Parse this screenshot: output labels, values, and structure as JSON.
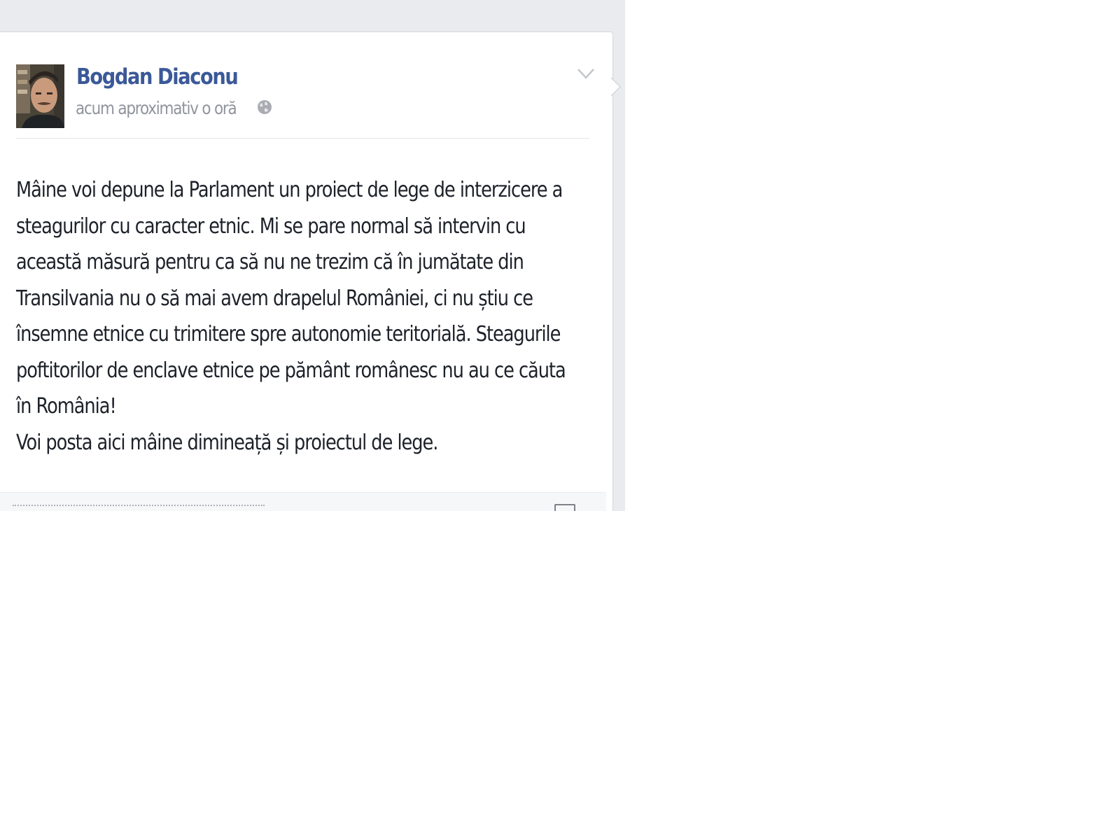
{
  "post": {
    "author": "Bogdan Diaconu",
    "timestamp": "acum aproximativ o oră",
    "privacy_icon": "globe-icon",
    "options_icon": "chevron-down-icon",
    "body": [
      "Mâine voi depune la Parlament un proiect de lege de interzicere a",
      "steagurilor cu caracter etnic. Mi se pare normal să intervin cu",
      "această măsură pentru ca să nu ne trezim că în jumătate din",
      "Transilvania nu o să mai avem drapelul României, ci nu știu ce",
      "însemne etnice cu trimitere spre autonomie teritorială. Steagurile",
      "poftitorilor de enclave etnice pe pământ românesc nu au ce căuta",
      "în România!",
      "Voi posta aici mâine dimineață și proiectul de lege."
    ]
  },
  "colors": {
    "link_blue": "#3b5998",
    "meta_gray": "#90949c",
    "text": "#1d2129",
    "page_bg": "#e9ebee"
  }
}
